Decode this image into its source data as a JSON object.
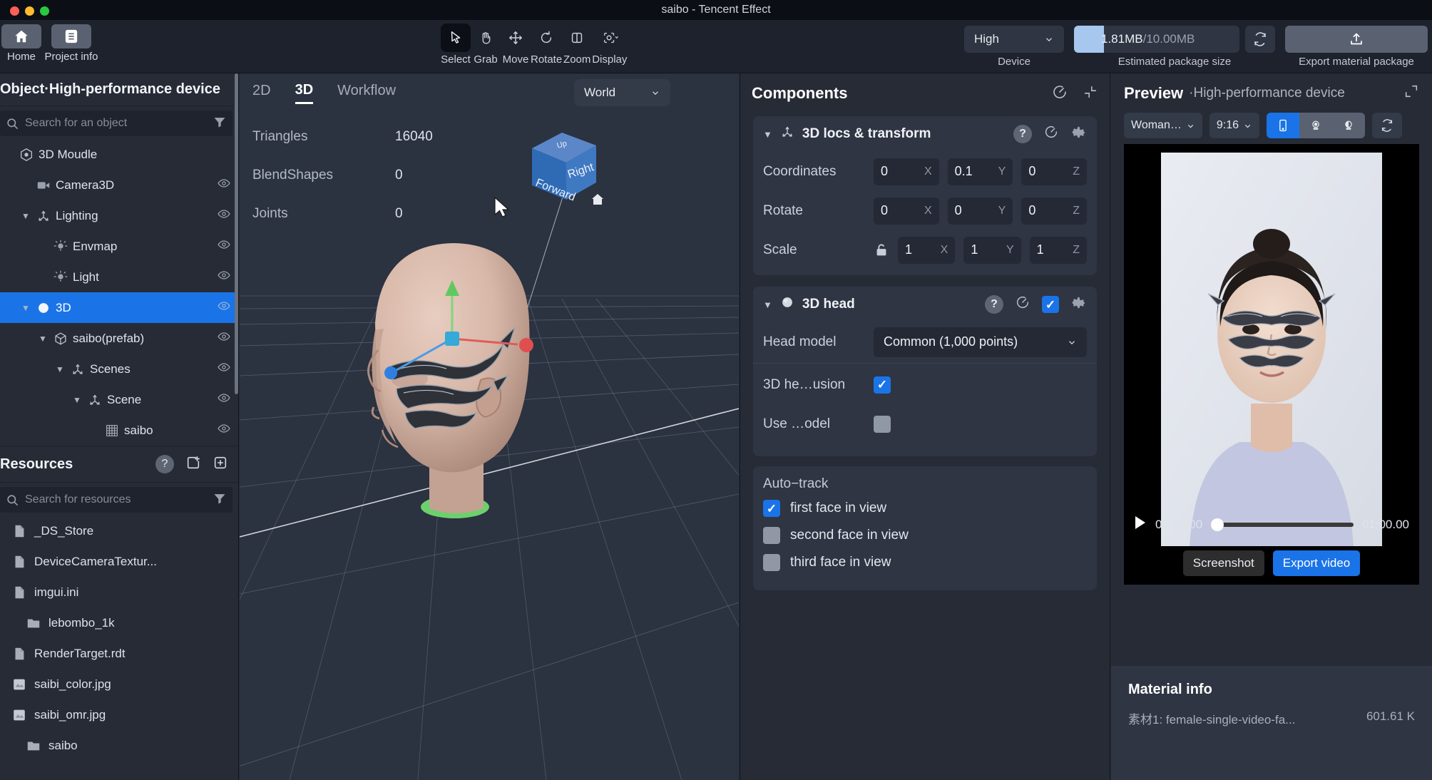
{
  "window": {
    "title": "saibo - Tencent Effect"
  },
  "toolbar": {
    "left_buttons": [
      {
        "icon": "home-icon",
        "label": "Home"
      },
      {
        "icon": "list-icon",
        "label": "Project info"
      }
    ],
    "tools": [
      {
        "icon": "cursor-icon",
        "label": "Select",
        "active": true
      },
      {
        "icon": "hand-icon",
        "label": "Grab",
        "active": false
      },
      {
        "icon": "move-icon",
        "label": "Move",
        "active": false
      },
      {
        "icon": "rotate-icon",
        "label": "Rotate",
        "active": false
      },
      {
        "icon": "zoom-icon",
        "label": "Zoom",
        "active": false
      },
      {
        "icon": "display-icon",
        "label": "Display",
        "active": false
      }
    ],
    "device": {
      "value": "High",
      "caption": "Device"
    },
    "package": {
      "used": "1.81MB",
      "total": "/10.00MB",
      "caption": "Estimated package size",
      "fill_percent": 18,
      "refresh_icon": "refresh-icon"
    },
    "export": {
      "label": "Export material package",
      "icon": "upload-icon"
    }
  },
  "left_panel": {
    "header": "Object·High-performance device",
    "search_placeholder": "Search for an object",
    "tree": [
      {
        "label": "3D Moudle",
        "depth": 0,
        "icon": "module-icon",
        "caret": "",
        "eye": false,
        "selected": false
      },
      {
        "label": "Camera3D",
        "depth": 1,
        "icon": "camera-icon",
        "caret": "",
        "eye": true,
        "selected": false
      },
      {
        "label": "Lighting",
        "depth": 1,
        "icon": "axis-icon",
        "caret": "▼",
        "eye": true,
        "selected": false
      },
      {
        "label": "Envmap",
        "depth": 2,
        "icon": "light-icon",
        "caret": "",
        "eye": true,
        "selected": false
      },
      {
        "label": "Light",
        "depth": 2,
        "icon": "light-icon",
        "caret": "",
        "eye": true,
        "selected": false
      },
      {
        "label": "3D",
        "depth": 1,
        "icon": "sphere-icon",
        "caret": "▼",
        "eye": true,
        "selected": true
      },
      {
        "label": "saibo(prefab)",
        "depth": 2,
        "icon": "cube-icon",
        "caret": "▼",
        "eye": true,
        "selected": false
      },
      {
        "label": "Scenes",
        "depth": 3,
        "icon": "axis-icon",
        "caret": "▼",
        "eye": true,
        "selected": false
      },
      {
        "label": "Scene",
        "depth": 4,
        "icon": "axis-icon",
        "caret": "▼",
        "eye": true,
        "selected": false
      },
      {
        "label": "saibo",
        "depth": 5,
        "icon": "mesh-icon",
        "caret": "",
        "eye": true,
        "selected": false
      }
    ],
    "resources": {
      "title": "Resources",
      "help_icon": "question-icon",
      "new_folder_icon": "new-folder-icon",
      "add_icon": "plus-icon",
      "search_placeholder": "Search for resources",
      "items": [
        {
          "name": "_DS_Store",
          "icon": "file-icon"
        },
        {
          "name": "DeviceCameraTextur...",
          "icon": "file-icon"
        },
        {
          "name": "imgui.ini",
          "icon": "file-icon"
        },
        {
          "name": "lebombo_1k",
          "icon": "folder-icon"
        },
        {
          "name": "RenderTarget.rdt",
          "icon": "file-icon"
        },
        {
          "name": "saibi_color.jpg",
          "icon": "image-icon"
        },
        {
          "name": "saibi_omr.jpg",
          "icon": "image-icon"
        },
        {
          "name": "saibo",
          "icon": "folder-icon"
        }
      ]
    }
  },
  "viewport": {
    "tabs": [
      {
        "label": "2D",
        "active": false
      },
      {
        "label": "3D",
        "active": true
      },
      {
        "label": "Workflow",
        "active": false
      }
    ],
    "space_selector": "World",
    "stats": [
      {
        "key": "Triangles",
        "value": "16040"
      },
      {
        "key": "BlendShapes",
        "value": "0"
      },
      {
        "key": "Joints",
        "value": "0"
      }
    ],
    "viewcube": {
      "front": "Forward",
      "right": "Right",
      "top": "Up",
      "home_icon": "home-icon"
    }
  },
  "components": {
    "title": "Components",
    "header_icons": [
      "reset-icon",
      "collapse-icon"
    ],
    "transform": {
      "title": "3D locs & transform",
      "icon": "axis-icon",
      "actions": [
        "question-icon",
        "reset-icon",
        "gear-icon"
      ],
      "rows": [
        {
          "label": "Coordinates",
          "x": "0",
          "y": "0.1",
          "z": "0",
          "lock": false
        },
        {
          "label": "Rotate",
          "x": "0",
          "y": "0",
          "z": "0",
          "lock": false
        },
        {
          "label": "Scale",
          "x": "1",
          "y": "1",
          "z": "1",
          "lock": true
        }
      ],
      "axis_labels": [
        "X",
        "Y",
        "Z"
      ]
    },
    "head": {
      "title": "3D head",
      "icon": "sphere-icon",
      "actions": [
        "question-icon",
        "reset-icon",
        "checkbox-on",
        "gear-icon"
      ],
      "enabled": true,
      "head_model_label": "Head model",
      "head_model_value": "Common (1,000 points)",
      "options": [
        {
          "label": "3D he…usion",
          "checked": true
        },
        {
          "label": "Use …odel",
          "checked": false
        }
      ],
      "auto_track_label": "Auto−track",
      "auto_track": [
        {
          "label": "first face in view",
          "checked": true
        },
        {
          "label": "second face in view",
          "checked": false
        },
        {
          "label": "third face in view",
          "checked": false
        }
      ]
    }
  },
  "preview": {
    "title": "Preview",
    "subtitle": "·High-performance device",
    "expand_icon": "expand-icon",
    "source": "Woman…",
    "ratio": "9:16",
    "modes": [
      {
        "icon": "phone-icon",
        "active": true
      },
      {
        "icon": "camera-front-icon",
        "active": false
      },
      {
        "icon": "camera-back-icon",
        "active": false
      }
    ],
    "reload_icon": "refresh-icon",
    "player": {
      "play_icon": "play-icon",
      "current_time": "00:00.00",
      "total_time": "01:00.00",
      "progress_percent": 0
    },
    "buttons": {
      "screenshot": "Screenshot",
      "export_video": "Export video"
    },
    "material_info": {
      "title": "Material info",
      "rows": [
        {
          "name": "素材1: female-single-video-fa...",
          "size": "601.61 K"
        }
      ]
    }
  },
  "colors": {
    "accent": "#1a74e8",
    "panel": "#262b36",
    "card": "#2f3543",
    "viewport": "#2b3240",
    "titlebar": "#0b0e14"
  }
}
